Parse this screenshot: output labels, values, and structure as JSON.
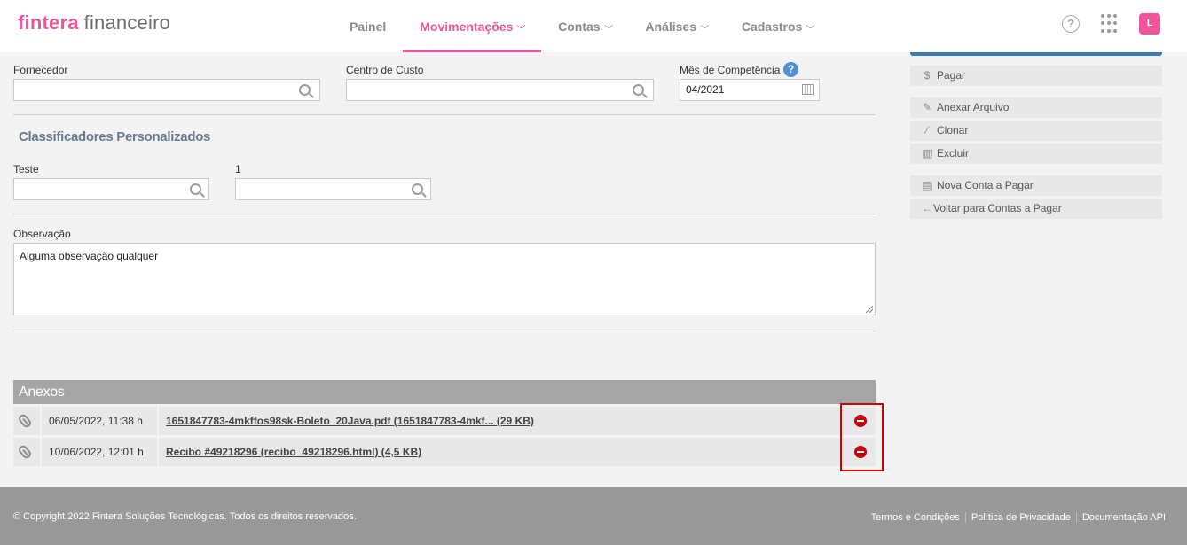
{
  "header": {
    "logo_brand": "fintera",
    "logo_product": "financeiro",
    "nav": [
      {
        "label": "Painel",
        "active": false,
        "dropdown": false
      },
      {
        "label": "Movimentações",
        "active": true,
        "dropdown": true
      },
      {
        "label": "Contas",
        "active": false,
        "dropdown": true
      },
      {
        "label": "Análises",
        "active": false,
        "dropdown": true
      },
      {
        "label": "Cadastros",
        "active": false,
        "dropdown": true
      }
    ],
    "help_icon": "?",
    "user_initial": "L"
  },
  "form": {
    "fornecedor_label": "Fornecedor",
    "fornecedor_value": "",
    "centro_custo_label": "Centro de Custo",
    "centro_custo_value": "",
    "mes_competencia_label": "Mês de Competência",
    "mes_competencia_value": "04/2021",
    "custom_section_title": "Classificadores Personalizados",
    "teste_label": "Teste",
    "teste_value": "",
    "field_1_label": "1",
    "field_1_value": "",
    "observacao_label": "Observação",
    "observacao_value": "Alguma observação qualquer"
  },
  "attachments": {
    "title": "Anexos",
    "rows": [
      {
        "date": "06/05/2022, 11:38 h",
        "file": "1651847783-4mkffos98sk-Boleto_20Java.pdf (1651847783-4mkf... (29 KB)"
      },
      {
        "date": "10/06/2022, 12:01 h",
        "file": "Recibo #49218296 (recibo_49218296.html) (4,5 KB)"
      }
    ]
  },
  "sidebar": {
    "pay": {
      "icon": "$",
      "label": "Pagar"
    },
    "attach": {
      "icon": "paperclip-icon",
      "label": "Anexar Arquivo"
    },
    "clone": {
      "icon": "magic-wand-icon",
      "label": "Clonar"
    },
    "delete": {
      "icon": "trash-icon",
      "label": "Excluir"
    },
    "new": {
      "icon": "document-icon",
      "label": "Nova Conta a Pagar"
    },
    "back": {
      "icon": "←",
      "label": "Voltar para Contas a Pagar"
    }
  },
  "footer": {
    "copyright": "© Copyright 2022 Fintera Soluções Tecnológicas. Todos os direitos reservados.",
    "links": [
      "Termos e Condições",
      "Política de Privacidade",
      "Documentação API"
    ]
  },
  "colors": {
    "brand_pink": "#f0559b",
    "sidebar_accent": "#3d7ab5",
    "remove_red": "#c8000b",
    "highlight_red": "#d40000"
  }
}
